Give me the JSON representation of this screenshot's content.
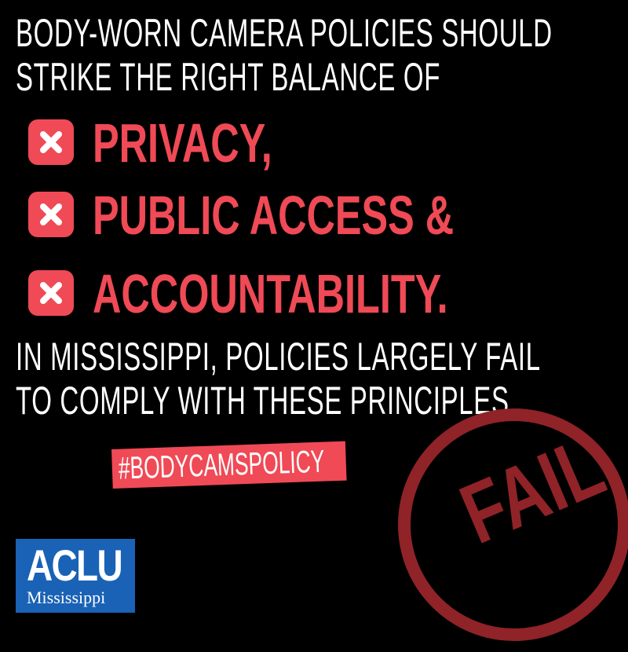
{
  "colors": {
    "background": "#000000",
    "accent_red": "#ef4a56",
    "stamp_red": "#8f2328",
    "aclu_blue": "#1a62b5",
    "text_white": "#ffffff"
  },
  "headline": {
    "line1": "BODY-WORN CAMERA POLICIES SHOULD",
    "line2": "STRIKE THE RIGHT BALANCE OF"
  },
  "items": [
    {
      "icon": "x-box-icon",
      "label": "PRIVACY,"
    },
    {
      "icon": "x-box-icon",
      "label": "PUBLIC ACCESS &"
    },
    {
      "icon": "x-box-icon",
      "label": "ACCOUNTABILITY."
    }
  ],
  "subline": {
    "line1": "IN MISSISSIPPI, POLICIES LARGELY FAIL",
    "line2": "TO COMPLY WITH THESE PRINCIPLES."
  },
  "hashtag": "#BODYCAMSPOLICY",
  "stamp": {
    "text": "FAIL"
  },
  "logo": {
    "main": "ACLU",
    "sub": "Mississippi"
  }
}
